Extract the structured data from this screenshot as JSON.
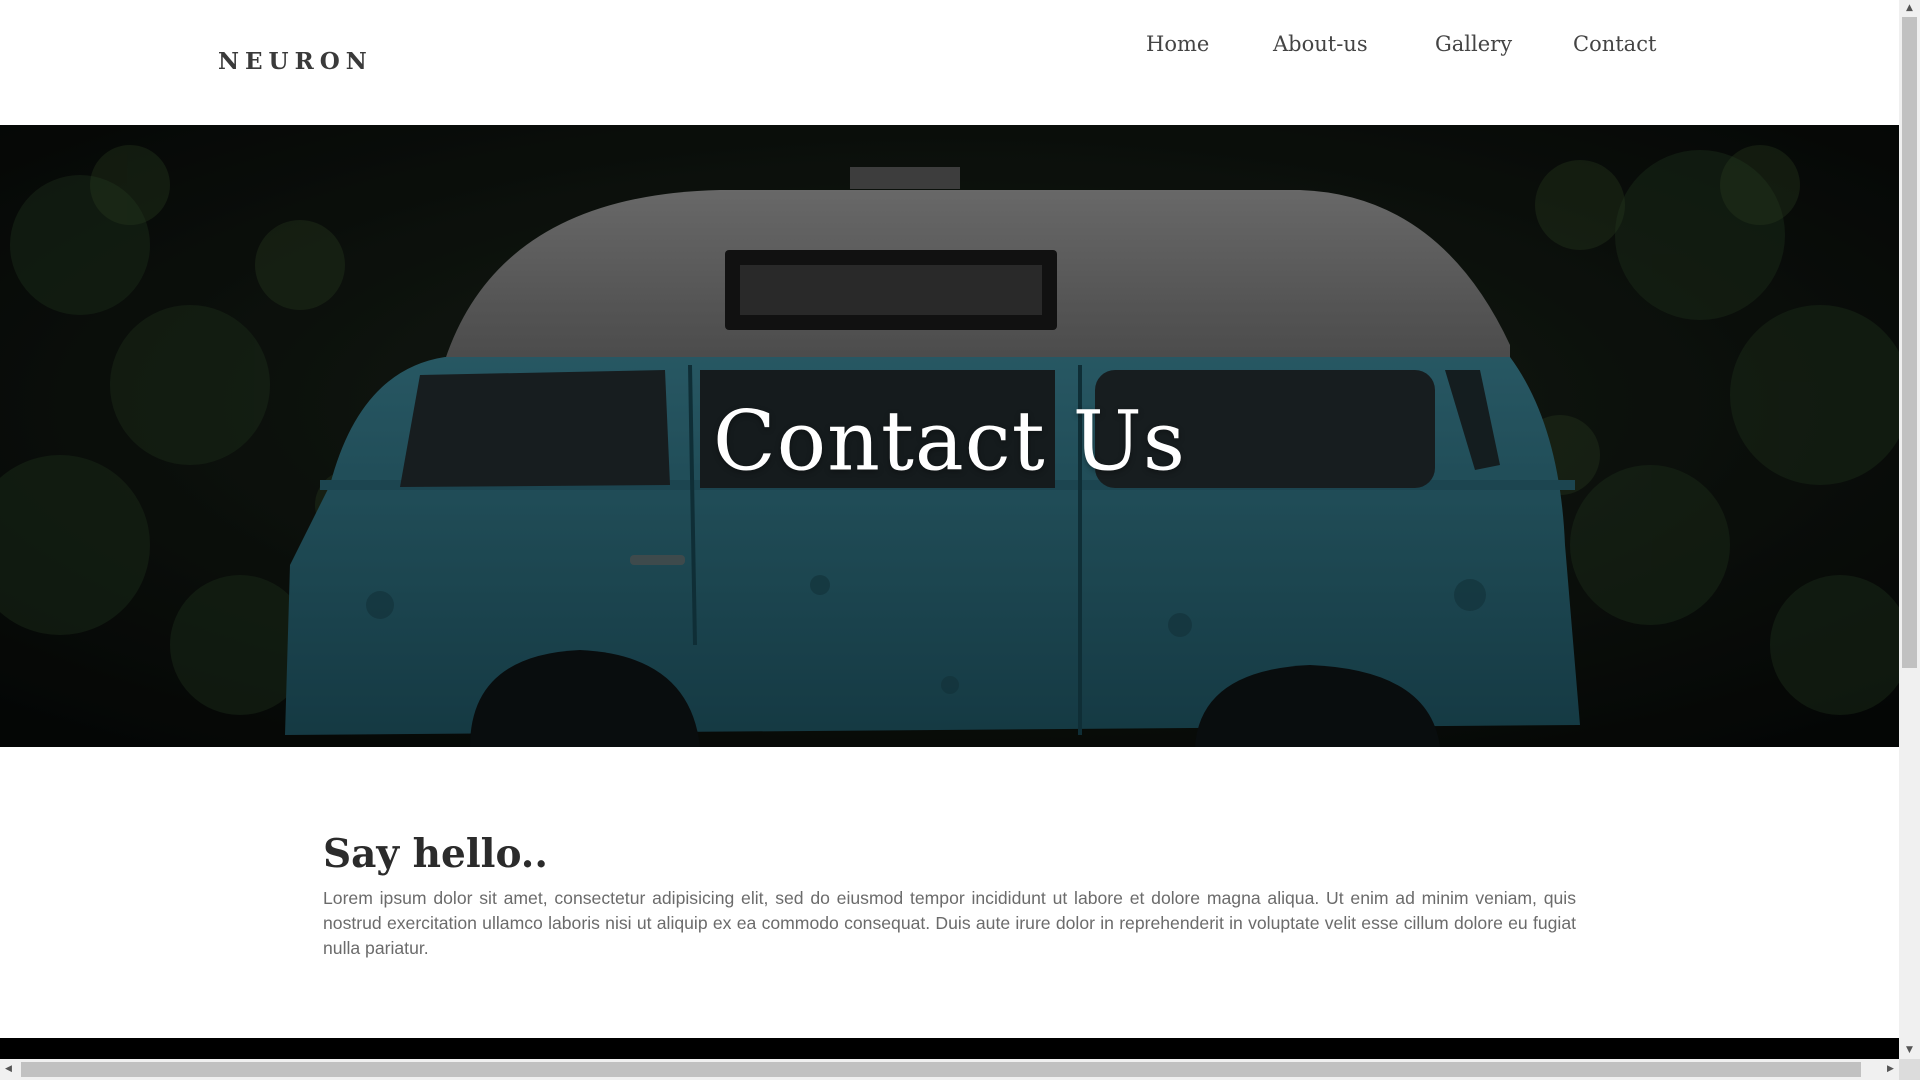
{
  "brand": "NEURON",
  "nav": {
    "items": [
      {
        "label": "Home"
      },
      {
        "label": "About-us"
      },
      {
        "label": "Gallery"
      },
      {
        "label": "Contact"
      }
    ]
  },
  "hero": {
    "title": "Contact Us",
    "image": "vintage-van-photo"
  },
  "content": {
    "heading": "Say hello..",
    "body": "Lorem ipsum dolor sit amet, consectetur adipisicing elit, sed do eiusmod tempor incididunt ut labore et dolore magna aliqua. Ut enim ad minim veniam, quis nostrud exercitation ullamco laboris nisi ut aliquip ex ea commodo consequat. Duis aute irure dolor in reprehenderit in voluptate velit esse cillum dolore eu fugiat nulla pariatur."
  },
  "scrollbar": {
    "up_icon": "triangle-up-icon",
    "down_icon": "triangle-down-icon",
    "left_icon": "triangle-left-icon",
    "right_icon": "triangle-right-icon"
  },
  "colors": {
    "van_teal": "#2e6e7f",
    "van_roof": "#8a8a8a",
    "foliage": "#1c2a1a",
    "footer": "#000000"
  }
}
